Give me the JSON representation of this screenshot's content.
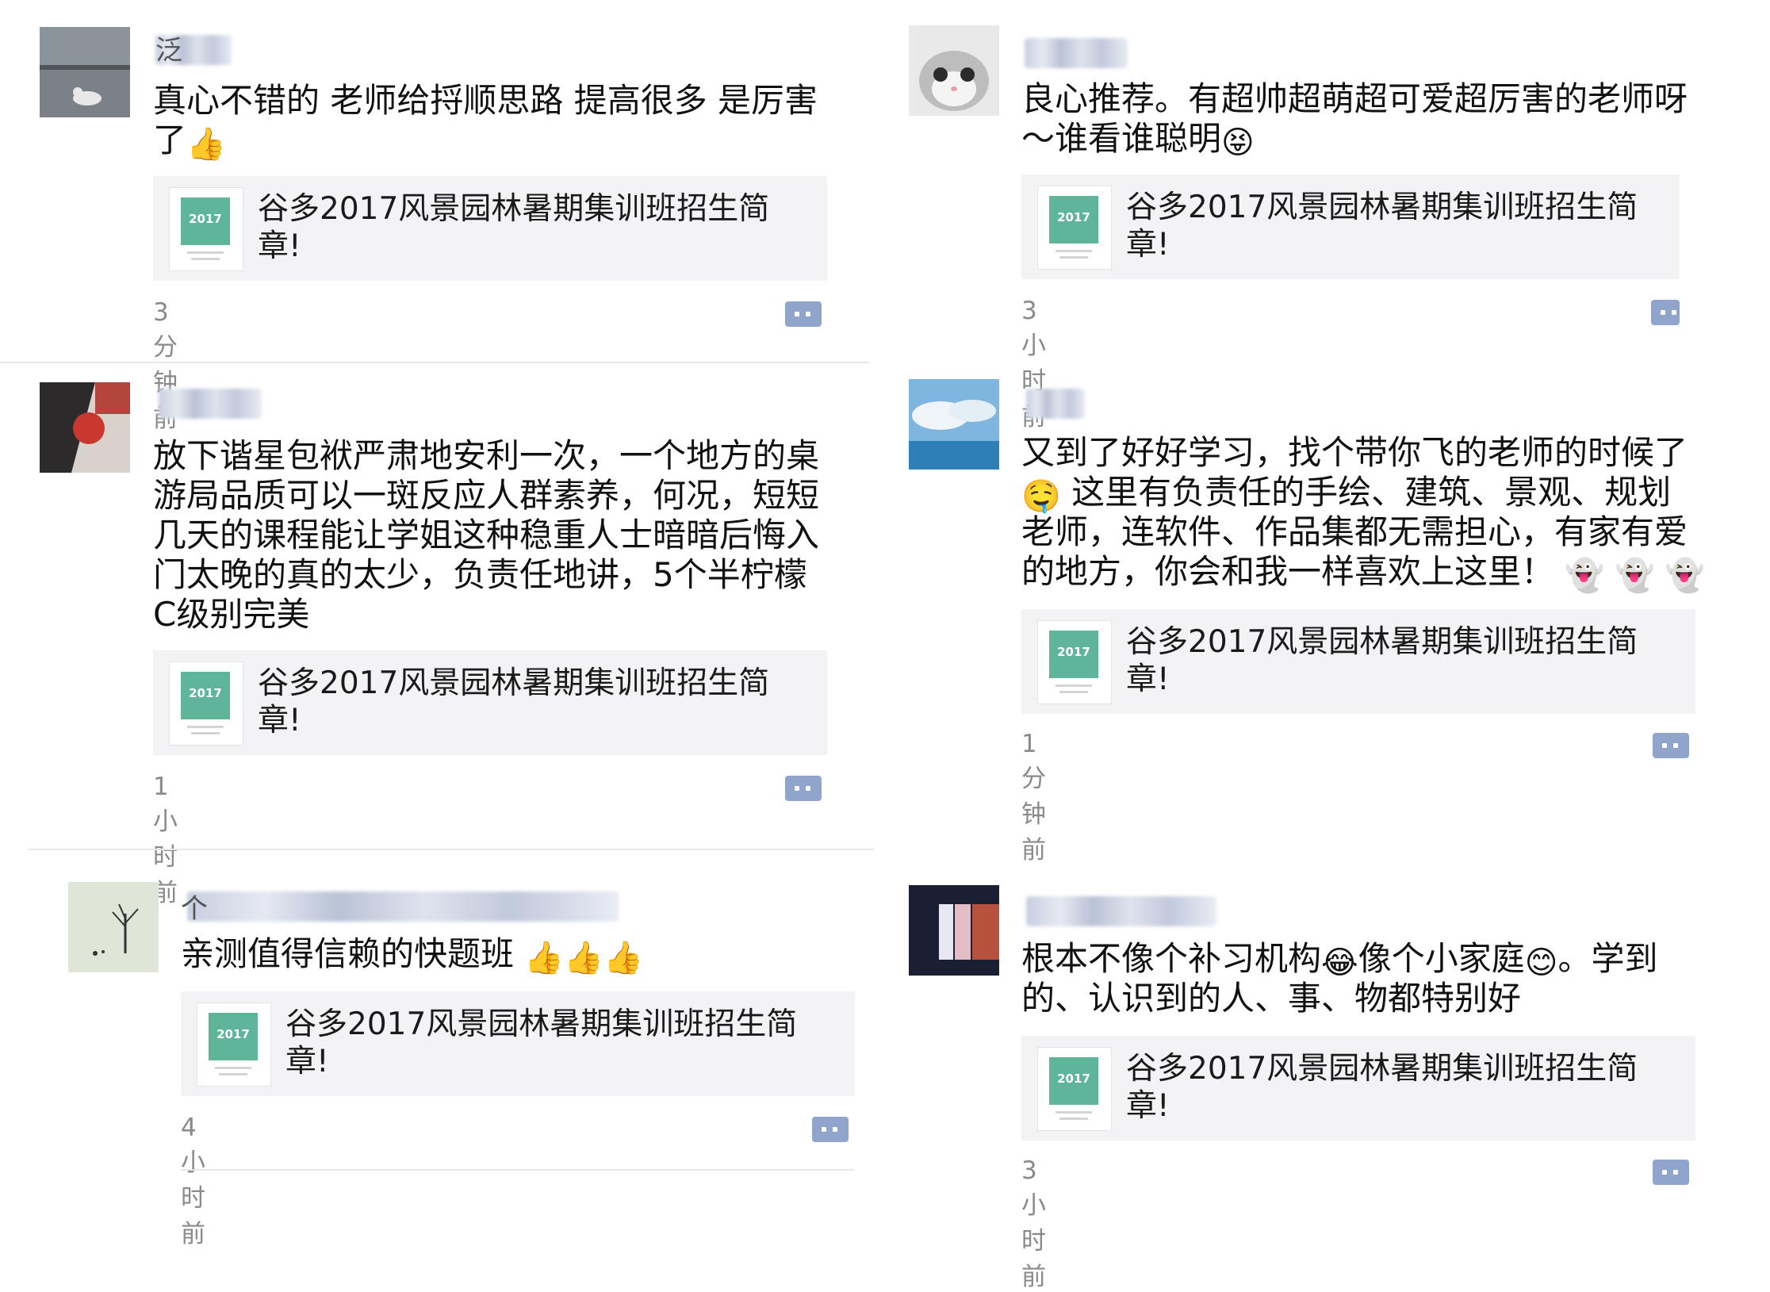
{
  "posts": [
    {
      "id": "p1",
      "username_initial": "泛",
      "text_lines": [
        "真心不错的 老师给捋顺思路 提高很多 是厉害",
        "了"
      ],
      "emoji_after": [
        "thumbs-up"
      ],
      "card_title_lines": [
        "谷多2017风景园林暑期集训班招生简",
        "章!"
      ],
      "time": "3分钟前"
    },
    {
      "id": "p2",
      "username_initial": "",
      "text_lines": [
        "良心推荐。有超帅超萌超可爱超厉害的老师呀",
        "～谁看谁聪明"
      ],
      "emoji_after": [
        "tongue-face"
      ],
      "card_title_lines": [
        "谷多2017风景园林暑期集训班招生简",
        "章!"
      ],
      "time": "3小时前"
    },
    {
      "id": "p3",
      "username_initial": "",
      "text_lines": [
        "放下谐星包袱严肃地安利一次，一个地方的桌",
        "游局品质可以一斑反应人群素养，何况，短短",
        "几天的课程能让学姐这种稳重人士暗暗后悔入",
        "门太晚的真的太少，负责任地讲，5个半柠檬",
        "C级别完美"
      ],
      "card_title_lines": [
        "谷多2017风景园林暑期集训班招生简",
        "章!"
      ],
      "time": "1小时前"
    },
    {
      "id": "p4",
      "username_initial": "",
      "text_lines": [
        "又到了好好学习，找个带你飞的老师的时候了",
        "这里有负责任的手绘、建筑、景观、规划",
        "老师，连软件、作品集都无需担心，有家有爱",
        "的地方，你会和我一样喜欢上这里！"
      ],
      "card_title_lines": [
        "谷多2017风景园林暑期集训班招生简",
        "章!"
      ],
      "time": "1分钟前"
    },
    {
      "id": "p5",
      "username_initial": "个",
      "text_lines": [
        "亲测值得信赖的快题班"
      ],
      "card_title_lines": [
        "谷多2017风景园林暑期集训班招生简",
        "章!"
      ],
      "time": "4小时前"
    },
    {
      "id": "p6",
      "username_initial": "",
      "text_lines": [
        "根本不像个补习机构",
        "像个小家庭",
        "。学到",
        "的、认识到的人、事、物都特别好"
      ],
      "card_title_lines": [
        "谷多2017风景园林暑期集训班招生简",
        "章!"
      ],
      "time": "3小时前"
    }
  ],
  "card_cover": {
    "year": "2017"
  },
  "emoji": {
    "thumbs_up": "👍",
    "tongue": "😝",
    "grin_sweat": "🤤",
    "ghost": "👻",
    "laugh_cry": "😂",
    "smile": "😊"
  },
  "colors": {
    "card_bg": "#f3f3f5",
    "comment_icon": "#8fa5cc",
    "time": "#8a8a8a"
  }
}
